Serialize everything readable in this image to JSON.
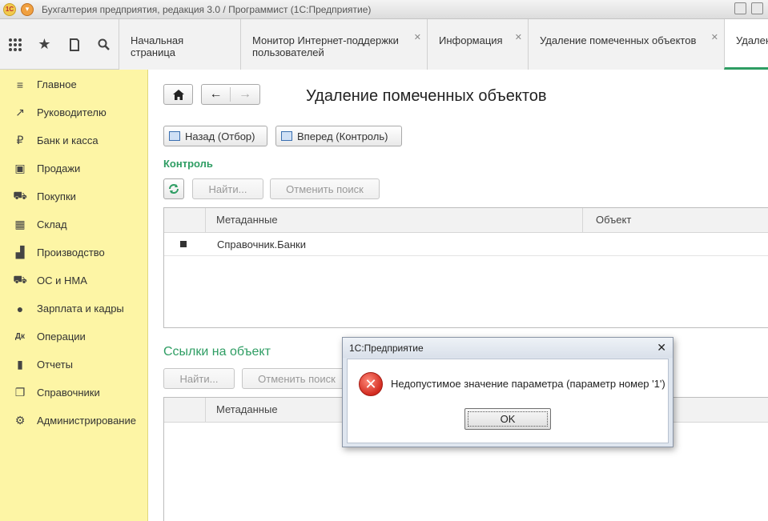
{
  "titlebar": {
    "title": "Бухгалтерия предприятия, редакция 3.0 / Программист  (1С:Предприятие)",
    "logo_text": "1С"
  },
  "toolbar": {
    "icons": [
      "apps-grid-icon",
      "star-icon",
      "history-icon",
      "search-icon"
    ]
  },
  "tabs": [
    {
      "label": "Начальная страница",
      "closable": false
    },
    {
      "label": "Монитор Интернет-поддержки пользователей",
      "closable": true
    },
    {
      "label": "Информация",
      "closable": true
    },
    {
      "label": "Удаление помеченных объектов",
      "closable": true
    },
    {
      "label": "Удален",
      "closable": false,
      "active": true
    }
  ],
  "sidebar": {
    "items": [
      {
        "label": "Главное",
        "icon": "menu-lines-icon",
        "glyph": "≡"
      },
      {
        "label": "Руководителю",
        "icon": "trend-icon",
        "glyph": "↗"
      },
      {
        "label": "Банк и касса",
        "icon": "ruble-coin-icon",
        "glyph": "₽"
      },
      {
        "label": "Продажи",
        "icon": "shopping-bag-icon",
        "glyph": "▣"
      },
      {
        "label": "Покупки",
        "icon": "cart-icon",
        "glyph": "⛟"
      },
      {
        "label": "Склад",
        "icon": "warehouse-icon",
        "glyph": "▦"
      },
      {
        "label": "Производство",
        "icon": "factory-icon",
        "glyph": "▟"
      },
      {
        "label": "ОС и НМА",
        "icon": "truck-icon",
        "glyph": "⛟"
      },
      {
        "label": "Зарплата и кадры",
        "icon": "person-icon",
        "glyph": "●"
      },
      {
        "label": "Операции",
        "icon": "debit-credit-icon",
        "glyph": "Дк"
      },
      {
        "label": "Отчеты",
        "icon": "bar-chart-icon",
        "glyph": "▮"
      },
      {
        "label": "Справочники",
        "icon": "books-icon",
        "glyph": "❐"
      },
      {
        "label": "Администрирование",
        "icon": "gear-icon",
        "glyph": "⚙"
      }
    ]
  },
  "page": {
    "title": "Удаление помеченных объектов",
    "back_label": "Назад (Отбор)",
    "forward_label": "Вперед (Контроль)"
  },
  "control": {
    "section_title": "Контроль",
    "find_label": "Найти...",
    "cancel_search_label": "Отменить поиск",
    "columns": [
      "Метаданные",
      "Объект"
    ],
    "rows": [
      {
        "metadata": "Справочник.Банки",
        "object": ""
      }
    ]
  },
  "links": {
    "section_title": "Ссылки на объект",
    "find_label": "Найти...",
    "cancel_search_label": "Отменить поиск",
    "columns": [
      "Метаданные"
    ]
  },
  "dialog": {
    "title": "1С:Предприятие",
    "message": "Недопустимое значение параметра (параметр номер '1')",
    "ok_label": "OK"
  }
}
